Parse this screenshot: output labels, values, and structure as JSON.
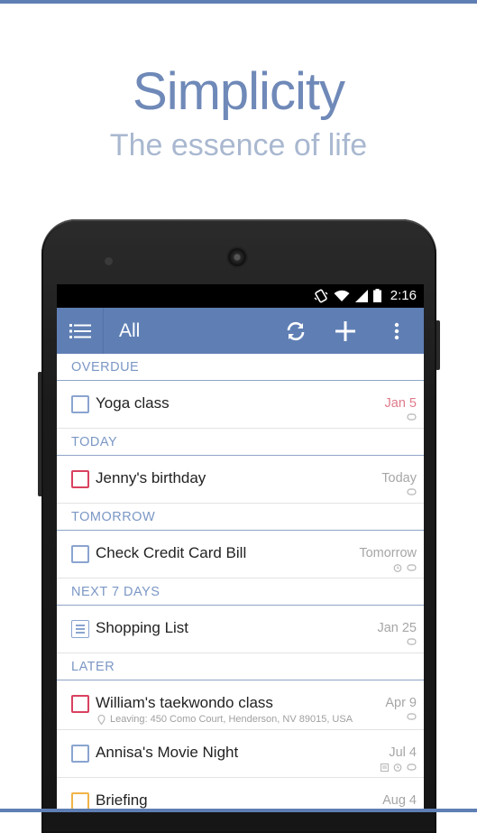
{
  "promo": {
    "headline": "Simplicity",
    "subheadline": "The essence of life"
  },
  "status_bar": {
    "time": "2:16",
    "icons": [
      "vibrate-icon",
      "wifi-icon",
      "signal-icon",
      "battery-icon"
    ]
  },
  "app_bar": {
    "title": "All",
    "actions": [
      "menu-icon",
      "sync-icon",
      "add-icon",
      "more-icon"
    ]
  },
  "sections": [
    {
      "header": "OVERDUE",
      "tasks": [
        {
          "title": "Yoga class",
          "date": "Jan 5",
          "checkbox_color": "#8aa4d0",
          "date_color": "#e07a8a",
          "meta": [
            "repeat-icon"
          ]
        }
      ]
    },
    {
      "header": "TODAY",
      "tasks": [
        {
          "title": "Jenny's birthday",
          "date": "Today",
          "checkbox_color": "#d9415f",
          "meta": [
            "repeat-icon"
          ]
        }
      ]
    },
    {
      "header": "TOMORROW",
      "tasks": [
        {
          "title": "Check Credit Card Bill",
          "date": "Tomorrow",
          "checkbox_color": "#8aa4d0",
          "meta": [
            "alarm-icon",
            "repeat-icon"
          ]
        }
      ]
    },
    {
      "header": "NEXT 7 DAYS",
      "tasks": [
        {
          "title": "Shopping List",
          "date": "Jan 25",
          "checklist": true,
          "meta": [
            "repeat-icon"
          ]
        }
      ]
    },
    {
      "header": "LATER",
      "tasks": [
        {
          "title": "William's taekwondo class",
          "subtitle": "Leaving: 450 Como Court, Henderson, NV 89015, USA",
          "date": "Apr 9",
          "checkbox_color": "#d9415f",
          "meta": [
            "repeat-icon"
          ]
        },
        {
          "title": "Annisa's Movie Night",
          "date": "Jul 4",
          "checkbox_color": "#8aa4d0",
          "meta": [
            "note-icon",
            "alarm-icon",
            "repeat-icon"
          ]
        },
        {
          "title": "Briefing",
          "date": "Aug 4",
          "checkbox_color": "#f0b447",
          "meta": [
            "repeat-icon"
          ]
        }
      ]
    }
  ],
  "colors": {
    "accent": "#5f7fb4",
    "section_text": "#7b97c5",
    "overdue_date": "#e07a8a"
  }
}
